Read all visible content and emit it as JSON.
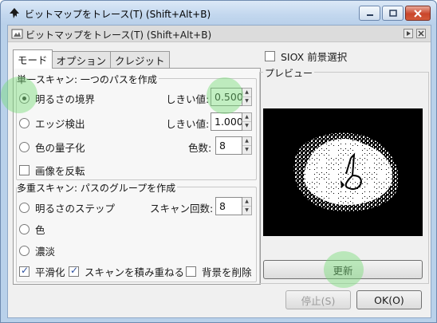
{
  "window": {
    "title": "ビットマップをトレース(T) (Shift+Alt+B)"
  },
  "dialog": {
    "title": "ビットマップをトレース(T) (Shift+Alt+B)"
  },
  "tabs": [
    {
      "label": "モード",
      "active": true
    },
    {
      "label": "オプション",
      "active": false
    },
    {
      "label": "クレジット",
      "active": false
    }
  ],
  "single_scan": {
    "title": "単一スキャン: 一つのパスを作成",
    "options": [
      {
        "label": "明るさの境界",
        "selected": true,
        "param_label": "しきい値:",
        "param_value": "0.500"
      },
      {
        "label": "エッジ検出",
        "selected": false,
        "param_label": "しきい値:",
        "param_value": "1.000"
      },
      {
        "label": "色の量子化",
        "selected": false,
        "param_label": "色数:",
        "param_value": "8"
      }
    ],
    "invert_label": "画像を反転",
    "invert_checked": false
  },
  "multi_scan": {
    "title": "多重スキャン: パスのグループを作成",
    "options": [
      {
        "label": "明るさのステップ",
        "selected": false,
        "param_label": "スキャン回数:",
        "param_value": "8"
      },
      {
        "label": "色",
        "selected": false
      },
      {
        "label": "濃淡",
        "selected": false
      }
    ],
    "checks": [
      {
        "label": "平滑化",
        "checked": true
      },
      {
        "label": "スキャンを積み重ねる",
        "checked": true
      },
      {
        "label": "背景を削除",
        "checked": false
      }
    ]
  },
  "siox": {
    "label": "SIOX 前景選択",
    "checked": false
  },
  "preview": {
    "title": "プレビュー",
    "update_label": "更新"
  },
  "buttons": {
    "stop": "停止(S)",
    "ok": "OK(O)"
  },
  "colors": {
    "titlebar": "#c2d7ee",
    "accent_highlight": "#78dc78",
    "preview_bg": "#000000"
  }
}
